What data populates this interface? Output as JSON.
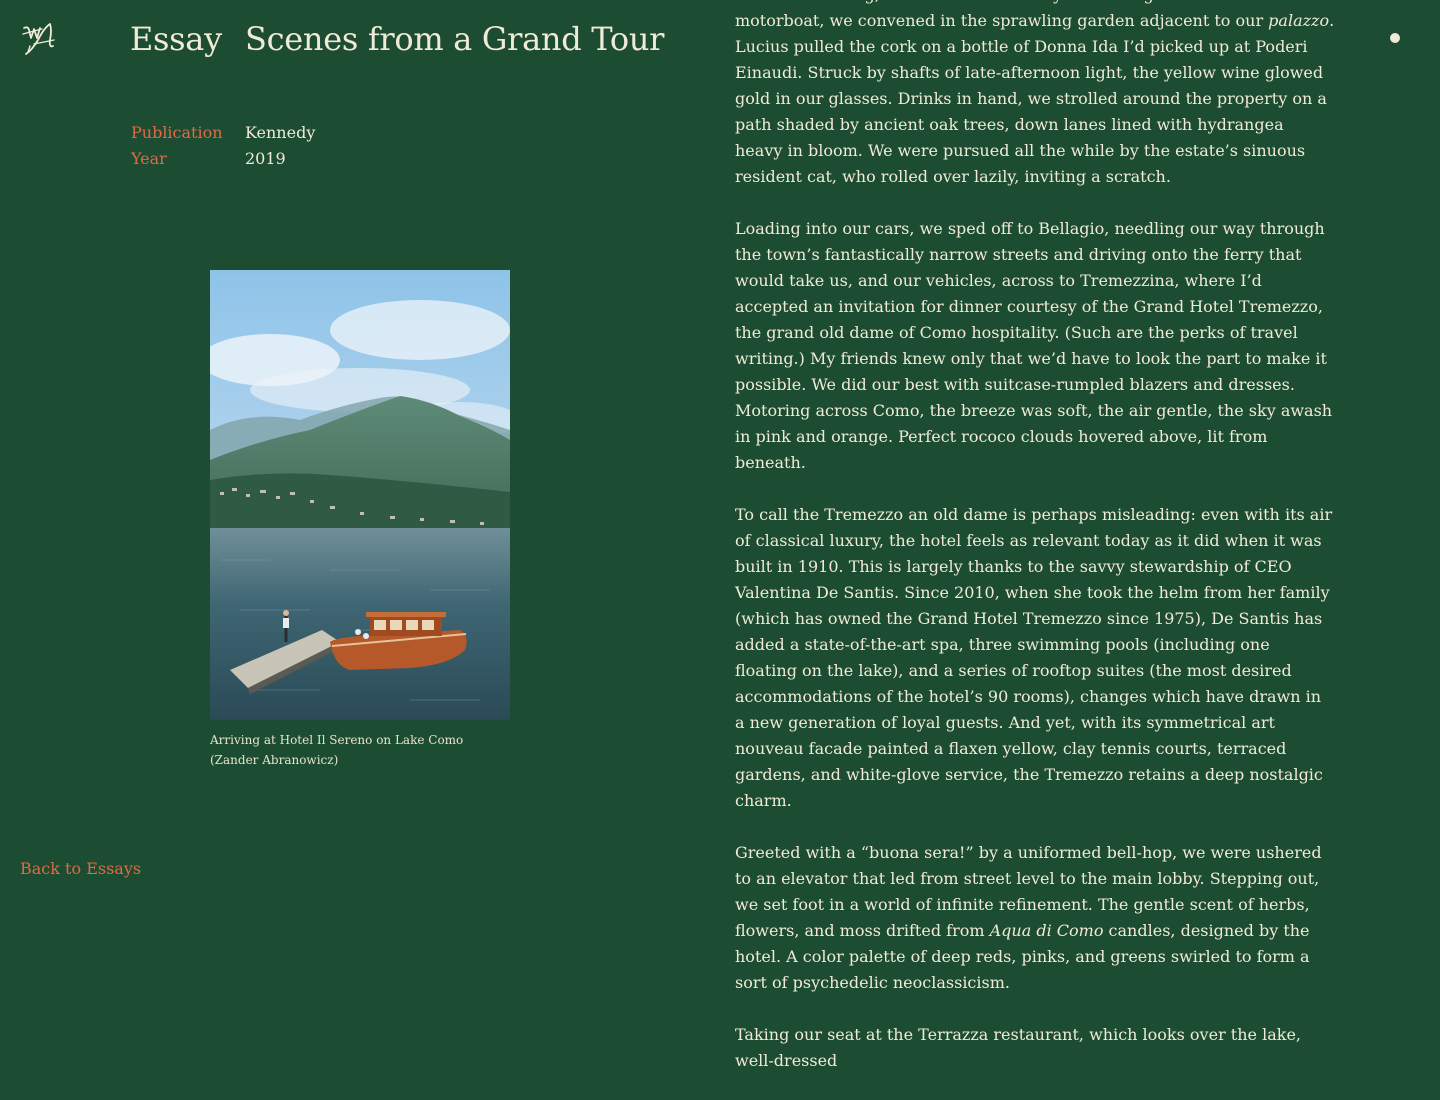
{
  "header": {
    "logo_alt": "WA monogram",
    "section": "Essay",
    "title": "Scenes from a Grand Tour"
  },
  "meta": [
    {
      "key": "Publication",
      "value": "Kennedy"
    },
    {
      "key": "Year",
      "value": "2019"
    }
  ],
  "figure": {
    "caption": "Arriving at Hotel Il Sereno on Lake Como (Zander Abranowicz)"
  },
  "nav": {
    "back_label": "Back to Essays"
  },
  "article": {
    "p1": {
      "a": "The next evening, sun-kissed from a day of cruising Como in a rented motorboat, we convened in the sprawling garden adjacent to our ",
      "em": "palazzo",
      "b": ". Lucius pulled the cork on a bottle of Donna Ida I’d picked up at Poderi Einaudi. Struck by shafts of late-afternoon light, the yellow wine glowed gold in our glasses. Drinks in hand, we strolled around the property on a path shaded by ancient oak trees, down lanes lined with hydrangea heavy in bloom. We were pursued all the while by the estate’s sinuous resident cat, who rolled over lazily, inviting a scratch."
    },
    "p2": "Loading into our cars, we sped off to Bellagio, needling our way through the town’s fantastically narrow streets and driving onto the ferry that would take us, and our vehicles, across to Tremezzina, where I’d accepted an invitation for dinner courtesy of the Grand Hotel Tremezzo, the grand old dame of Como hospitality. (Such are the perks of travel writing.) My friends knew only that we’d have to look the part to make it possible. We did our best with suitcase-rumpled blazers and dresses. Motoring across Como, the breeze was soft, the air gentle, the sky awash in pink and orange. Perfect rococo clouds hovered above, lit from beneath.",
    "p3": "To call the Tremezzo an old dame is perhaps misleading: even with its air of classical luxury, the hotel feels as relevant today as it did when it was built in 1910. This is largely thanks to the savvy stewardship of CEO Valentina De Santis. Since 2010, when she took the helm from her family (which has owned the Grand Hotel Tremezzo since 1975), De Santis has added a state-of-the-art spa, three swimming pools (including one floating on the lake), and a series of rooftop suites (the most desired accommodations of the hotel’s 90 rooms), changes which have drawn in a new generation of loyal guests. And yet, with its symmetrical art nouveau facade painted a flaxen yellow, clay tennis courts, terraced gardens, and white-glove service, the Tremezzo retains a deep nostalgic charm.",
    "p4": {
      "a": "Greeted with a “buona sera!” by a uniformed bell-hop, we were ushered to an elevator that led from street level to the main lobby. Stepping out, we set foot in a world of infinite refinement. The gentle scent of herbs, flowers, and moss drifted from ",
      "em": "Aqua di Como",
      "b": " candles, designed by the hotel. A color palette of deep reds, pinks, and greens swirled to form a sort of psychedelic neoclassicism."
    },
    "p5": "Taking our seat at the Terrazza restaurant, which looks over the lake, well-dressed"
  },
  "colors": {
    "background": "#1c4d32",
    "text": "#f1ead6",
    "accent": "#e06a43"
  }
}
